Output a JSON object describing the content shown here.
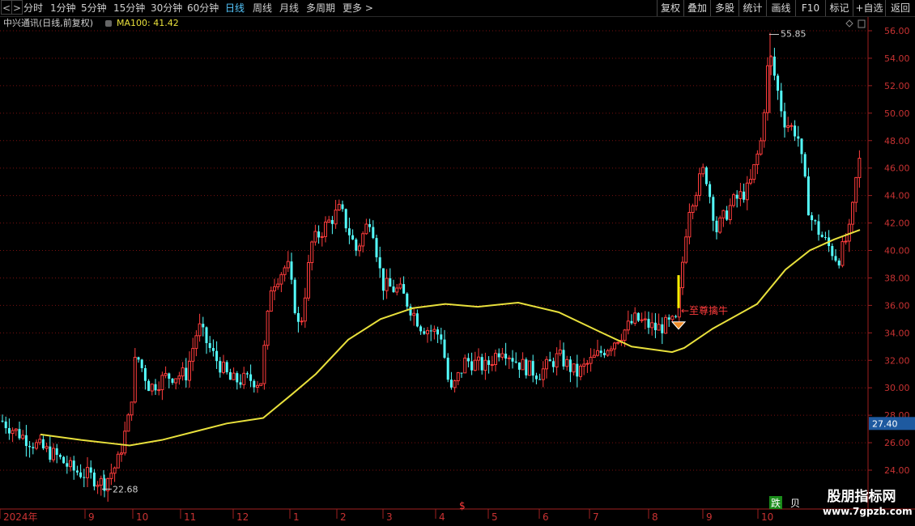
{
  "topbar": {
    "nav_prev": "<",
    "nav_next": ">",
    "periods": [
      {
        "label": "分时",
        "active": false
      },
      {
        "label": "1分钟",
        "active": false
      },
      {
        "label": "5分钟",
        "active": false
      },
      {
        "label": "15分钟",
        "active": false
      },
      {
        "label": "30分钟",
        "active": false
      },
      {
        "label": "60分钟",
        "active": false
      },
      {
        "label": "日线",
        "active": true
      },
      {
        "label": "周线",
        "active": false
      },
      {
        "label": "月线",
        "active": false
      },
      {
        "label": "多周期",
        "active": false
      },
      {
        "label": "更多 >",
        "active": false
      }
    ],
    "tools": [
      "复权",
      "叠加",
      "多股",
      "统计",
      "画线",
      "F10",
      "标记",
      "+自选",
      "返回"
    ]
  },
  "infobar": {
    "title": "中兴通讯(日线,前复权)",
    "ma_label": "MA100: 41.42",
    "ma_color": "#e8e03c"
  },
  "chart_data": {
    "type": "candlestick",
    "ylim": [
      22,
      57
    ],
    "y_ticks": [
      "24.00",
      "26.00",
      "28.00",
      "30.00",
      "32.00",
      "34.00",
      "36.00",
      "38.00",
      "40.00",
      "42.00",
      "44.00",
      "46.00",
      "48.00",
      "50.00",
      "52.00",
      "54.00",
      "56.00"
    ],
    "x_labels": [
      "2024年",
      "9",
      "10",
      "11",
      "12",
      "1",
      "2",
      "3",
      "4",
      "5",
      "6",
      "7",
      "8",
      "9",
      "10"
    ],
    "price_tag": "27.40",
    "annotations": {
      "high": "55.85",
      "low": "22.68",
      "signal": "←至尊擒牛"
    },
    "bottom_marks": {
      "dollar": "$",
      "die": "跌",
      "bei": "贝"
    },
    "series": [
      {
        "name": "MA100",
        "color": "#e8e03c"
      }
    ],
    "up_color": "#ff3c3c",
    "down_color": "#54ffff"
  },
  "watermark": {
    "title": "股朋指标网",
    "url": "www.7gpzb.com"
  }
}
